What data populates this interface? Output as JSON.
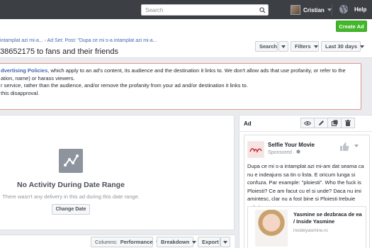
{
  "topbar": {
    "search_placeholder": "Search",
    "user_name": "Cristian",
    "help_label": "Help"
  },
  "header": {
    "create_ad_label": "Create Ad",
    "breadcrumb_campaign": "intamplat azi mi-a...",
    "breadcrumb_separator": "›",
    "breadcrumb_adset": "Ad Set: Post: \"Dupa ce mi s-a intamplat azi mi-a...",
    "title": "38652175 to fans and their friends",
    "search_label": "Search",
    "filters_label": "Filters",
    "date_range_label": "Last 30 days"
  },
  "warning": {
    "line1_link": "dvertising Policies",
    "line1_rest": ", which apply to an ad's content, its audience and the destination it links to. We don't allow ads that use profanity, or refer to the",
    "line2": "ation, name) or harass viewers.",
    "line3": "r service, rather than the audience, and/or remove the profanity from your ad and/or destination it links to.",
    "line4": "this disapproval."
  },
  "activity": {
    "title": "No Activity During Date Range",
    "subtitle": "There wasn't any delivery in this ad during this date range.",
    "change_date_label": "Change Date"
  },
  "toolbar": {
    "columns_label": "Columns:",
    "columns_value": "Performance",
    "breakdown_label": "Breakdown",
    "export_label": "Export"
  },
  "ad_preview": {
    "heading": "Ad",
    "page_name": "Selfie Your Movie",
    "sponsored": "Sponsored · ",
    "body": "Dupa ce mi s-a intamplat azi mi-am dat seama ca nu e indeajuns sa tin o lista. E oricum lunga si confuza. Par example: \"ploiesti\". Who the fuck is Ploiesti? Ce am facut cu el si unde? Daca nu imi amintesc, clar nu a fost bine si Ploiesti trebuie evitat.",
    "link_title": "Yasmine se dezbraca de ea / Inside Yasmine",
    "link_domain": "insideyasmine.ro"
  }
}
